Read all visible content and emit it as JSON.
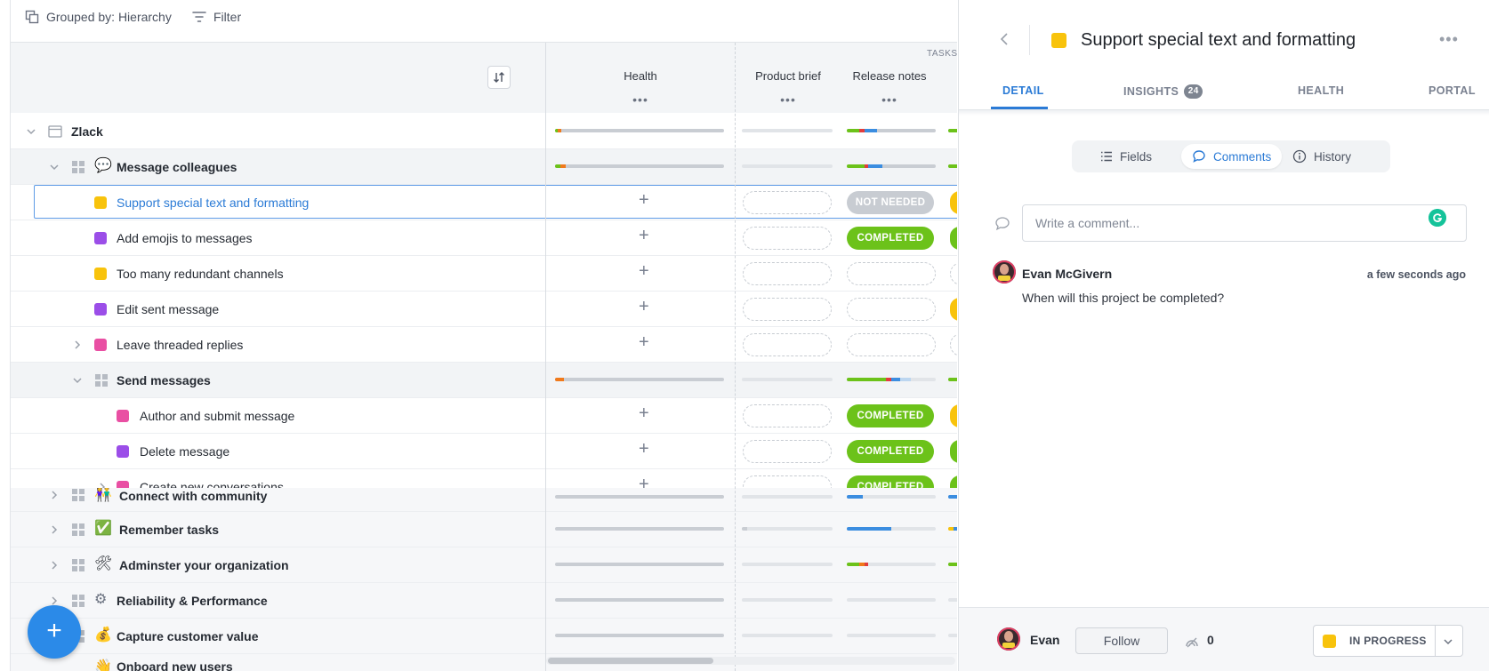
{
  "toolbar": {
    "grouped_label": "Grouped by: Hierarchy",
    "filter_label": "Filter"
  },
  "table": {
    "tasks_label": "TASKS",
    "columns": [
      {
        "label": "Health",
        "more": "•••"
      },
      {
        "label": "Product brief",
        "more": "•••"
      },
      {
        "label": "Release notes",
        "more": "•••"
      }
    ],
    "status_completed": "COMPLETED",
    "status_not_needed": "NOT NEEDED",
    "add_symbol": "+",
    "rows": {
      "zlack": "Zlack",
      "message_colleagues": "Message colleagues",
      "support_text": "Support special text and formatting",
      "add_emojis": "Add emojis to messages",
      "redundant_channels": "Too many redundant channels",
      "edit_sent": "Edit sent message",
      "threaded_replies": "Leave threaded replies",
      "send_messages": "Send messages",
      "author_submit": "Author and submit message",
      "delete_message": "Delete message",
      "create_conversations": "Create new conversations",
      "connect_community": "Connect with community",
      "remember_tasks": "Remember tasks",
      "administer_org": "Adminster your organization",
      "reliability": "Reliability & Performance",
      "capture_value": "Capture customer value",
      "onboard_users": "Onboard new users"
    },
    "emojis": {
      "message_colleagues": "💬",
      "connect_community": "👫",
      "remember_tasks": "✅",
      "administer_org": "🛠",
      "reliability": "⚙",
      "capture_value": "💰",
      "onboard_users": "👋"
    },
    "colors": {
      "yellow": "#f8c30c",
      "purple": "#9b4ee8",
      "pink": "#e94fa3",
      "green": "#6cc21a",
      "blue": "#3b8de0",
      "orange": "#f07a1c",
      "red": "#e23d3d"
    }
  },
  "fab": {
    "label": "+"
  },
  "panel": {
    "title": "Support special text and formatting",
    "more": "•••",
    "tabs": {
      "detail": "DETAIL",
      "insights": "INSIGHTS",
      "insights_count": "24",
      "health": "HEALTH",
      "portal": "PORTAL"
    },
    "segments": {
      "fields": "Fields",
      "comments": "Comments",
      "history": "History"
    },
    "comment_placeholder": "Write a comment...",
    "comment": {
      "author": "Evan McGivern",
      "time": "a few seconds ago",
      "text": "When will this project be completed?"
    },
    "footer": {
      "user": "Evan",
      "follow_label": "Follow",
      "watchers": "0",
      "status": "IN PROGRESS"
    }
  }
}
